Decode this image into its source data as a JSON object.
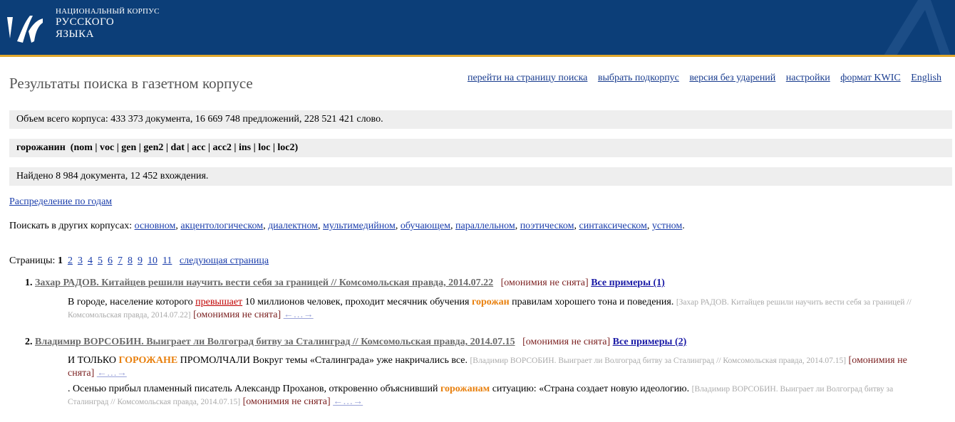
{
  "header": {
    "logo_line1": "НАЦИОНАЛЬНЫЙ КОРПУС",
    "logo_line2": "РУССКОГО",
    "logo_line3": "ЯЗЫКА"
  },
  "page_title": "Результаты поиска в газетном корпусе",
  "nav": [
    {
      "label": "перейти на страницу поиска"
    },
    {
      "label": "выбрать подкорпус"
    },
    {
      "label": "версия без ударений"
    },
    {
      "label": "настройки"
    },
    {
      "label": "формат KWIC"
    },
    {
      "label": "English"
    }
  ],
  "corpus_size": "Объем всего корпуса: 433 373 документа, 16 669 748 предложений, 228 521 421 слово.",
  "query": "горожанин  (nom | voc | gen | gen2 | dat | acc | acc2 | ins | loc | loc2)",
  "found": "Найдено 8 984 документа, 12 452 вхождения.",
  "distribution_link": "Распределение по годам",
  "other_corpora": {
    "label": "Поискать в других корпусах:",
    "links": [
      "основном",
      "акцентологическом",
      "диалектном",
      "мультимедийном",
      "обучающем",
      "параллельном",
      "поэтическом",
      "синтаксическом",
      "устном"
    ]
  },
  "pages": {
    "label": "Страницы:",
    "current": "1",
    "others": [
      "2",
      "3",
      "4",
      "5",
      "6",
      "7",
      "8",
      "9",
      "10",
      "11"
    ],
    "next": "следующая страница"
  },
  "results": [
    {
      "num": "1.",
      "title": "Захар РАДОВ. Китайцев решили научить вести себя за границей // Комсомольская правда, 2014.07.22",
      "homonymy": "[омонимия не снята]",
      "all_examples": "Все примеры (1)",
      "snippets": [
        {
          "pre": "В городе, население которого ",
          "red": "превышает",
          "mid": " 10 миллионов человек, проходит месячник обучения ",
          "hit": "горожан",
          "post": " правилам хорошего тона и поведения. ",
          "source": "[Захар РАДОВ. Китайцев решили научить вести себя за границей // Комсомольская правда, 2014.07.22]",
          "homonymy": "[омонимия не снята]",
          "arrows": "←…→"
        }
      ]
    },
    {
      "num": "2.",
      "title": "Владимир ВОРСОБИН. Выиграет ли Волгоград битву за Сталинград // Комсомольская правда, 2014.07.15",
      "homonymy": "[омонимия не снята]",
      "all_examples": "Все примеры (2)",
      "snippets": [
        {
          "pre": "И ТОЛЬКО ",
          "hit": "ГОРОЖАНЕ",
          "post": " ПРОМОЛЧАЛИ Вокруг темы «Сталинграда» уже накричались все. ",
          "source": "[Владимир ВОРСОБИН. Выиграет ли Волгоград битву за Сталинград // Комсомольская правда, 2014.07.15]",
          "homonymy": "[омонимия не снята]",
          "arrows": "←…→"
        },
        {
          "pre": ". Осенью прибыл пламенный писатель Александр Проханов, откровенно объяснивший ",
          "hit": "горожанам",
          "post": " ситуацию: «Страна создает новую идеологию. ",
          "source": "[Владимир ВОРСОБИН. Выиграет ли Волгоград битву за Сталинград // Комсомольская правда, 2014.07.15]",
          "homonymy": "[омонимия не снята]",
          "arrows": "←…→"
        }
      ]
    }
  ],
  "colors": {
    "header_bg": "#0c3e78",
    "header_stripe": "#e0a72c",
    "hit": "#e8800e",
    "link": "#1a3dab"
  }
}
